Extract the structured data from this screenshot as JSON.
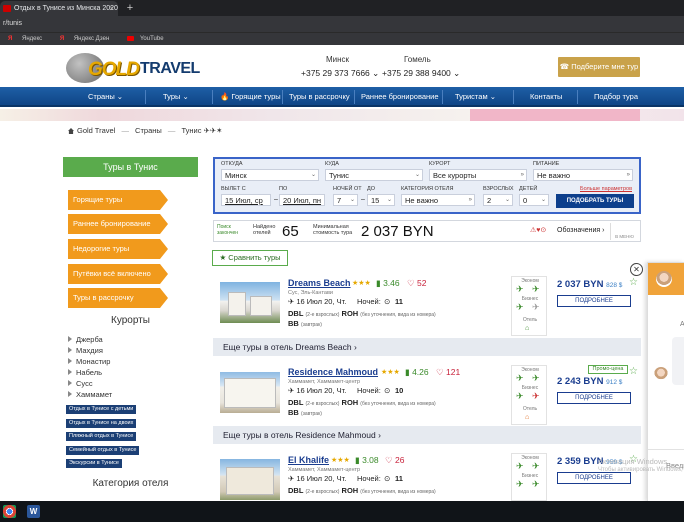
{
  "browser": {
    "tab_title": "Отдых в Тунисе из Минска 2020",
    "address": "r/tunis",
    "bookmarks": [
      {
        "label": "Яндекс"
      },
      {
        "label": "Яндекс Дзен"
      },
      {
        "label": "YouTube"
      }
    ]
  },
  "header": {
    "logo_gold": "GOLD",
    "logo_travel": "TRAVEL",
    "offices": [
      {
        "city": "Минск",
        "phone": "+375 29 373 7666 ⌄"
      },
      {
        "city": "Гомель",
        "phone": "+375 29 388 9400 ⌄"
      }
    ],
    "pick_tour_button": "☎ Подберите мне тур"
  },
  "nav": {
    "items": [
      "Страны ⌄",
      "Туры ⌄",
      "🔥 Горящие туры",
      "Туры в рассрочку",
      "Раннее бронирование",
      "Туристам ⌄",
      "Контакты",
      "Подбор тура"
    ]
  },
  "breadcrumb": {
    "home": "Gold Travel",
    "sep": "—",
    "level2": "Страны",
    "current": "Тунис ✈✈✶"
  },
  "sidebar": {
    "title": "Туры в Тунис",
    "buttons": [
      "Горящие туры",
      "Раннее бронирование",
      "Недорогие туры",
      "Путёвки всё включено",
      "Туры в рассрочку"
    ],
    "resorts_title": "Курорты",
    "resorts": [
      "Джерба",
      "Махдия",
      "Монастир",
      "Набель",
      "Сусс",
      "Хаммамет"
    ],
    "tags": [
      "Отдых в Тунисе с детьми",
      "Отдых в Тунисе на двоих",
      "Пляжный отдых в Тунисе",
      "Семейный отдых в Тунисе",
      "Экскурсии в Тунисе"
    ],
    "category_title": "Категория отеля"
  },
  "search": {
    "from_label": "ОТКУДА",
    "from_value": "Минск",
    "to_label": "КУДА",
    "to_value": "Тунис",
    "resort_label": "КУРОРТ",
    "resort_value": "Все курорты",
    "food_label": "ПИТАНИЕ",
    "food_value": "Не важно",
    "depart_label": "ВЫЛЕТ С",
    "depart_from": "15 Июл, ср",
    "to_date_label": "ПО",
    "depart_to": "20 Июл, пн",
    "nights_label": "НОЧЕЙ ОТ",
    "nights_from": "7",
    "nights_to_label": "ДО",
    "nights_to": "15",
    "category_label": "КАТЕГОРИЯ ОТЕЛЯ",
    "category_value": "Не важно",
    "adults_label": "ВЗРОСЛЫХ",
    "adults_value": "2",
    "children_label": "ДЕТЕЙ",
    "children_value": "0",
    "more_params": "Больше параметров",
    "find_button": "ПОДОБРАТЬ ТУРЫ"
  },
  "stats": {
    "search_done": "Поиск закончен",
    "found_label": "Найдено отелей",
    "found_value": "65",
    "min_label": "Минимальная стоимость тура",
    "min_value": "2 037 BYN",
    "legend_label": "Обозначения ›",
    "ask_label": "В МЕНЮ"
  },
  "compare_button": "★ Сравнить туры",
  "hotels": [
    {
      "name": "Dreams Beach",
      "stars": "★★★",
      "rating": "3.46",
      "likes": "52",
      "location": "Сус, Эль-Кантави",
      "dates": "✈ 16 Июл 20, Чт.",
      "nights_label": "Ночей:",
      "nights": "11",
      "room1_code": "DBL",
      "room1_note": "(2-е взрослых)",
      "room2_code": "ROH",
      "room2_note": "(без уточнения, вида из номера)",
      "meal_code": "BB",
      "meal_note": "(завтрак)",
      "flight_economy": "Эконом",
      "flight_business": "Бизнес",
      "hotel_label": "Отель",
      "price": "2 037 BYN",
      "price_alt": "828 $",
      "details_button": "ПОДРОБНЕЕ",
      "more_link": "Еще туры в отель Dreams Beach ›"
    },
    {
      "name": "Residence Mahmoud",
      "stars": "★★★",
      "rating": "4.26",
      "likes": "121",
      "location": "Хаммамет, Хаммамет-центр",
      "dates": "✈ 16 Июл 20, Чт.",
      "nights_label": "Ночей:",
      "nights": "10",
      "room1_code": "DBL",
      "room1_note": "(2-е взрослых)",
      "room2_code": "ROH",
      "room2_note": "(без уточнения, вида из номера)",
      "meal_code": "BB",
      "meal_note": "(завтрак)",
      "flight_economy": "Эконом",
      "flight_business": "Бизнес",
      "hotel_label": "Отель",
      "promo": "Промо-цена",
      "price": "2 243 BYN",
      "price_alt": "912 $",
      "details_button": "ПОДРОБНЕЕ",
      "more_link": "Еще туры в отель Residence Mahmoud ›"
    },
    {
      "name": "El Khalife",
      "stars": "★★★",
      "rating": "3.08",
      "likes": "26",
      "location": "Хаммамет, Хаммамет-центр",
      "dates": "✈ 16 Июл 20, Чт.",
      "nights_label": "Ночей:",
      "nights": "11",
      "room1_code": "DBL",
      "room1_note": "(2-е взрослых)",
      "room2_code": "ROH",
      "room2_note": "(без уточнения, вида из номера)",
      "flight_economy": "Эконом",
      "flight_business": "Бизнес",
      "price": "2 359 BYN",
      "price_alt": "959 $",
      "details_button": "ПОДРОБНЕЕ"
    }
  ],
  "chat": {
    "letter_a": "А",
    "side_text": "Введите",
    "close": "✕"
  },
  "watermark": {
    "line1": "Активация Windows",
    "line2": "Чтобы активировать Windows, перейдите в раздел «Параметры»."
  },
  "colors": {
    "nav": "#1e5fa6",
    "accent_orange": "#f19a1c",
    "accent_green": "#5aab4c",
    "gold": "#c9a24a"
  }
}
